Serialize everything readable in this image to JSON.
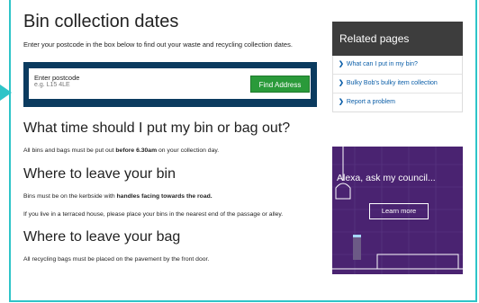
{
  "page_title": "Bin collection dates",
  "intro": "Enter your postcode in the box below to find out your waste and recycling collection dates.",
  "postcode": {
    "label": "Enter postcode",
    "placeholder": "e.g. L15 4LE",
    "button": "Find Address"
  },
  "sections": [
    {
      "heading": "What time should I put my bin or bag out?",
      "text_before": "All bins and bags must be put out ",
      "text_bold": "before 6.30am",
      "text_after": " on your collection day."
    },
    {
      "heading": "Where to leave your bin",
      "text_before": "Bins must be on the kerbside with ",
      "text_bold": "handles facing towards the road.",
      "text_after": "",
      "text2": "If you live in a terraced house, please place your bins in the nearest end of the passage or alley."
    },
    {
      "heading": "Where to leave your bag",
      "text_before": "All recycling bags must be placed on the pavement by the front door."
    }
  ],
  "related": {
    "title": "Related pages",
    "items": [
      "What can I put in my bin?",
      "Bulky Bob's bulky item collection",
      "Report a problem"
    ]
  },
  "promo": {
    "title": "Alexa, ask my council...",
    "button": "Learn more"
  },
  "colors": {
    "accent": "#2ec4c8",
    "panel": "#0b3b5f",
    "button": "#2a9a3a",
    "promo_bg": "#4a2371"
  }
}
